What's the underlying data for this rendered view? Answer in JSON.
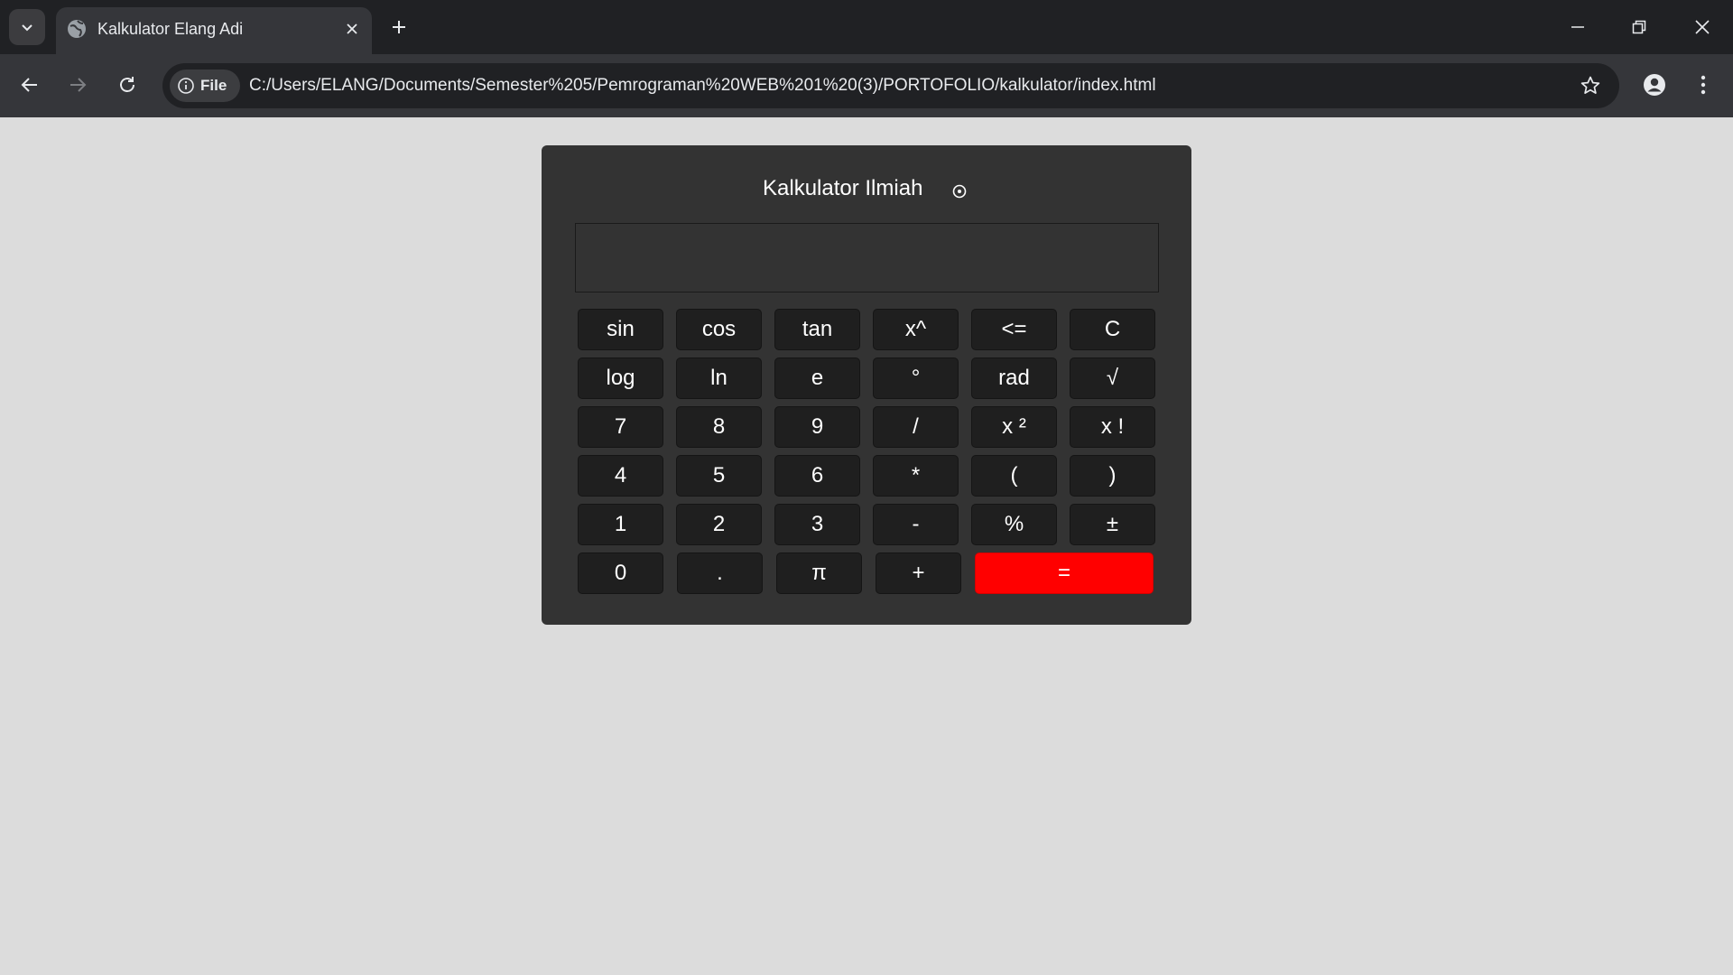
{
  "browser": {
    "tab_title": "Kalkulator Elang Adi",
    "site_chip_label": "File",
    "url": "C:/Users/ELANG/Documents/Semester%205/Pemrograman%20WEB%201%20(3)/PORTOFOLIO/kalkulator/index.html",
    "icons": {
      "tab_list": "chevron-down-icon",
      "favicon": "globe-icon",
      "tab_close": "close-icon",
      "new_tab": "plus-icon",
      "minimize": "minimize-icon",
      "restore": "restore-icon",
      "close": "close-icon",
      "back": "arrow-left-icon",
      "forward": "arrow-right-icon",
      "reload": "reload-icon",
      "site_info": "info-icon",
      "bookmark": "star-icon",
      "profile": "person-icon",
      "menu": "kebab-menu-icon"
    }
  },
  "calculator": {
    "title": "Kalkulator Ilmiah",
    "theme_toggle_icon": "circle-dot-icon",
    "display_value": "",
    "keys": [
      [
        "sin",
        "cos",
        "tan",
        "x^",
        "<=",
        "C"
      ],
      [
        "log",
        "ln",
        "e",
        "°",
        "rad",
        "√"
      ],
      [
        "7",
        "8",
        "9",
        "/",
        "x ²",
        "x !"
      ],
      [
        "4",
        "5",
        "6",
        "*",
        "(",
        ")"
      ],
      [
        "1",
        "2",
        "3",
        "-",
        "%",
        "±"
      ],
      [
        "0",
        ".",
        "π",
        "+",
        "="
      ]
    ],
    "colors": {
      "panel": "#333333",
      "key": "#1f1f1f",
      "equals": "#ff0000",
      "page_background": "#dcdcdc"
    }
  }
}
